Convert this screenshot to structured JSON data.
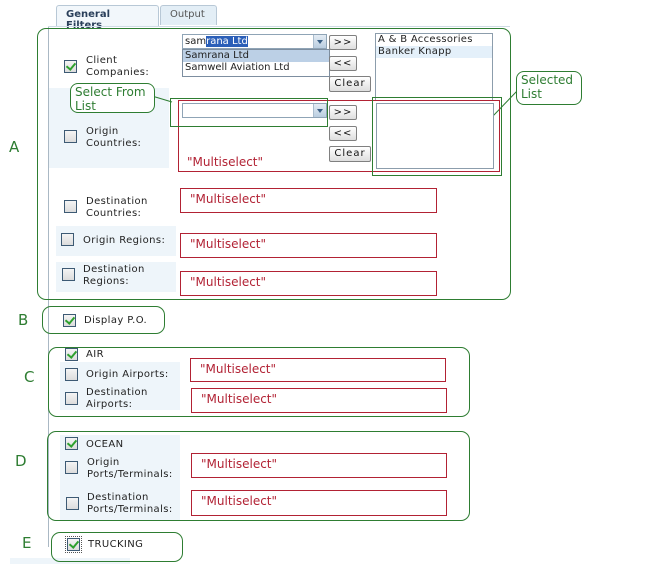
{
  "tabs": [
    {
      "label": "General Filters",
      "active": true
    },
    {
      "label": "Output",
      "active": false
    }
  ],
  "annotations": {
    "group_letters": [
      "A",
      "B",
      "C",
      "D",
      "E"
    ],
    "callout_select_from_list": "Select From List",
    "callout_selected_list": "Selected List",
    "accent_color": "#2e7d32",
    "placeholder_color": "#b22234"
  },
  "section_a": {
    "client_companies": {
      "label": "Client Companies:",
      "checked": true,
      "combo_typed": "sam",
      "combo_autocomplete": "rana Ltd",
      "dropdown_options": [
        "Samrana Ltd",
        "Samwell Aviation Ltd"
      ],
      "dropdown_highlighted": "Samrana Ltd",
      "buttons": {
        "add": ">>",
        "remove": "<<",
        "clear": "Clear"
      },
      "selected_list": [
        "A & B Accessories",
        "Banker Knapp"
      ]
    },
    "origin_countries": {
      "label": "Origin Countries:",
      "checked": false,
      "combo_value": "",
      "buttons": {
        "add": ">>",
        "remove": "<<",
        "clear": "Clear"
      },
      "placeholder": "\"Multiselect\""
    },
    "destination_countries": {
      "label": "Destination Countries:",
      "checked": false,
      "placeholder": "\"Multiselect\""
    },
    "origin_regions": {
      "label": "Origin Regions:",
      "checked": false,
      "placeholder": "\"Multiselect\""
    },
    "destination_regions": {
      "label": "Destination Regions:",
      "checked": false,
      "placeholder": "\"Multiselect\""
    }
  },
  "section_b": {
    "display_po": {
      "label": "Display P.O.",
      "checked": true
    }
  },
  "section_c": {
    "air": {
      "label": "AIR",
      "checked": true
    },
    "origin_airports": {
      "label": "Origin Airports:",
      "checked": false,
      "placeholder": "\"Multiselect\""
    },
    "destination_airports": {
      "label": "Destination Airports:",
      "checked": false,
      "placeholder": "\"Multiselect\""
    }
  },
  "section_d": {
    "ocean": {
      "label": "OCEAN",
      "checked": true
    },
    "origin_ports": {
      "label": "Origin Ports/Terminals:",
      "checked": false,
      "placeholder": "\"Multiselect\""
    },
    "destination_ports": {
      "label": "Destination Ports/Terminals:",
      "checked": false,
      "placeholder": "\"Multiselect\""
    }
  },
  "section_e": {
    "trucking": {
      "label": "TRUCKING",
      "checked": true
    }
  }
}
